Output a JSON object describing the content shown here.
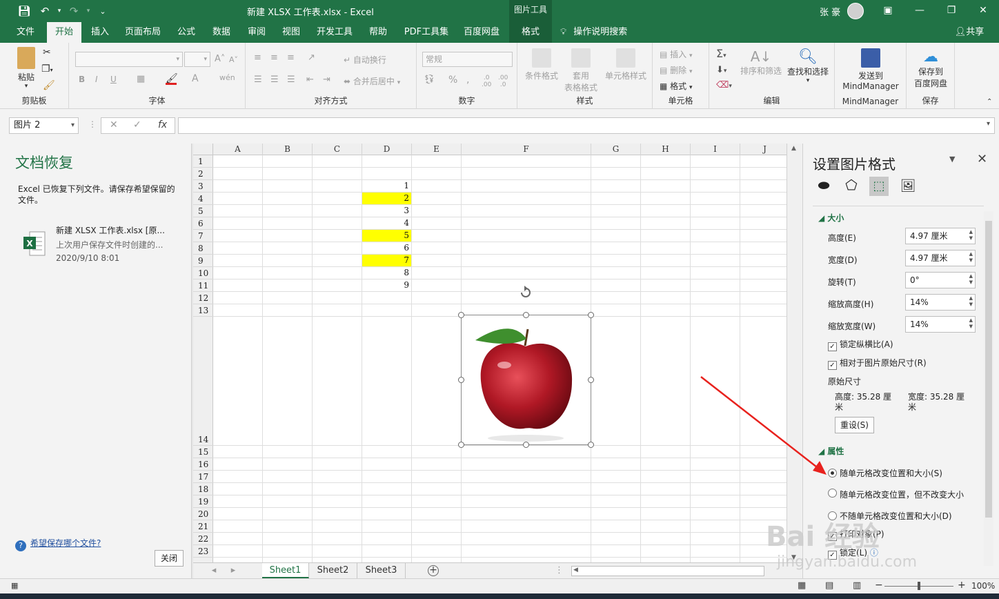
{
  "window": {
    "title": "新建 XLSX 工作表.xlsx  -  Excel",
    "contextual_tab_group": "图片工具",
    "user": "张 豪",
    "accent_color": "#217346"
  },
  "tabs": [
    "文件",
    "开始",
    "插入",
    "页面布局",
    "公式",
    "数据",
    "审阅",
    "视图",
    "开发工具",
    "帮助",
    "PDF工具集",
    "百度网盘",
    "格式"
  ],
  "search_label": "操作说明搜索",
  "share_label": "共享",
  "ribbon": {
    "clipboard": {
      "paste": "粘贴",
      "label": "剪贴板"
    },
    "font": {
      "label": "字体"
    },
    "alignment": {
      "wrap": "自动换行",
      "merge": "合并后居中",
      "label": "对齐方式"
    },
    "number": {
      "format": "常规",
      "percent": "%",
      "label": "数字"
    },
    "styles": {
      "conditional": "条件格式",
      "table": "套用",
      "table2": "表格格式",
      "cell": "单元格样式",
      "label": "样式"
    },
    "cells": {
      "insert": "插入",
      "delete": "删除",
      "format": "格式",
      "label": "单元格"
    },
    "editing": {
      "sort": "排序和筛选",
      "find": "查找和选择",
      "label": "编辑"
    },
    "mindmanager": {
      "send": "发送到",
      "send2": "MindManager",
      "label": "MindManager"
    },
    "save": {
      "save": "保存到",
      "save2": "百度网盘",
      "label": "保存"
    }
  },
  "formula_bar": {
    "name_box": "图片 2",
    "formula": ""
  },
  "recovery": {
    "title": "文档恢复",
    "message": "Excel 已恢复下列文件。请保存希望保留的文件。",
    "file_name": "新建 XLSX 工作表.xlsx  [原...",
    "file_desc": "上次用户保存文件时创建的...",
    "file_date": "2020/9/10 8:01",
    "help": "希望保存哪个文件?",
    "close": "关闭"
  },
  "sheet": {
    "columns": [
      "A",
      "B",
      "C",
      "D",
      "E",
      "F",
      "G",
      "H",
      "I",
      "J"
    ],
    "rows": [
      "1",
      "2",
      "3",
      "4",
      "5",
      "6",
      "7",
      "8",
      "9",
      "10",
      "11",
      "12",
      "13",
      "14",
      "15",
      "16",
      "17",
      "18",
      "19",
      "20",
      "21",
      "22",
      "23"
    ],
    "cells": [
      {
        "row": 3,
        "value": "1",
        "highlight": false
      },
      {
        "row": 4,
        "value": "2",
        "highlight": true
      },
      {
        "row": 5,
        "value": "3",
        "highlight": false
      },
      {
        "row": 6,
        "value": "4",
        "highlight": false
      },
      {
        "row": 7,
        "value": "5",
        "highlight": true
      },
      {
        "row": 8,
        "value": "6",
        "highlight": false
      },
      {
        "row": 9,
        "value": "7",
        "highlight": true
      },
      {
        "row": 10,
        "value": "8",
        "highlight": false
      },
      {
        "row": 11,
        "value": "9",
        "highlight": false
      }
    ],
    "highlight_color": "#ffff00",
    "tabs": [
      "Sheet1",
      "Sheet2",
      "Sheet3"
    ]
  },
  "format_pane": {
    "title": "设置图片格式",
    "size_section": "大小",
    "height_label": "高度(E)",
    "height_value": "4.97 厘米",
    "width_label": "宽度(D)",
    "width_value": "4.97 厘米",
    "rotation_label": "旋转(T)",
    "rotation_value": "0°",
    "scale_h_label": "缩放高度(H)",
    "scale_h_value": "14%",
    "scale_w_label": "缩放宽度(W)",
    "scale_w_value": "14%",
    "lock_ratio": "锁定纵横比(A)",
    "relative_orig": "相对于图片原始尺寸(R)",
    "orig_size": "原始尺寸",
    "orig_h": "高度:  35.28 厘米",
    "orig_w": "宽度:  35.28 厘米",
    "reset": "重设(S)",
    "props_section": "属性",
    "opt1": "随单元格改变位置和大小(S)",
    "opt2": "随单元格改变位置，但不改变大小",
    "opt3": "不随单元格改变位置和大小(D)",
    "print": "打印对象(P)",
    "locked": "锁定(L)"
  },
  "status": {
    "zoom": "100%"
  },
  "watermark": {
    "text": "Bai 经验",
    "url": "jingyan.baidu.com"
  }
}
